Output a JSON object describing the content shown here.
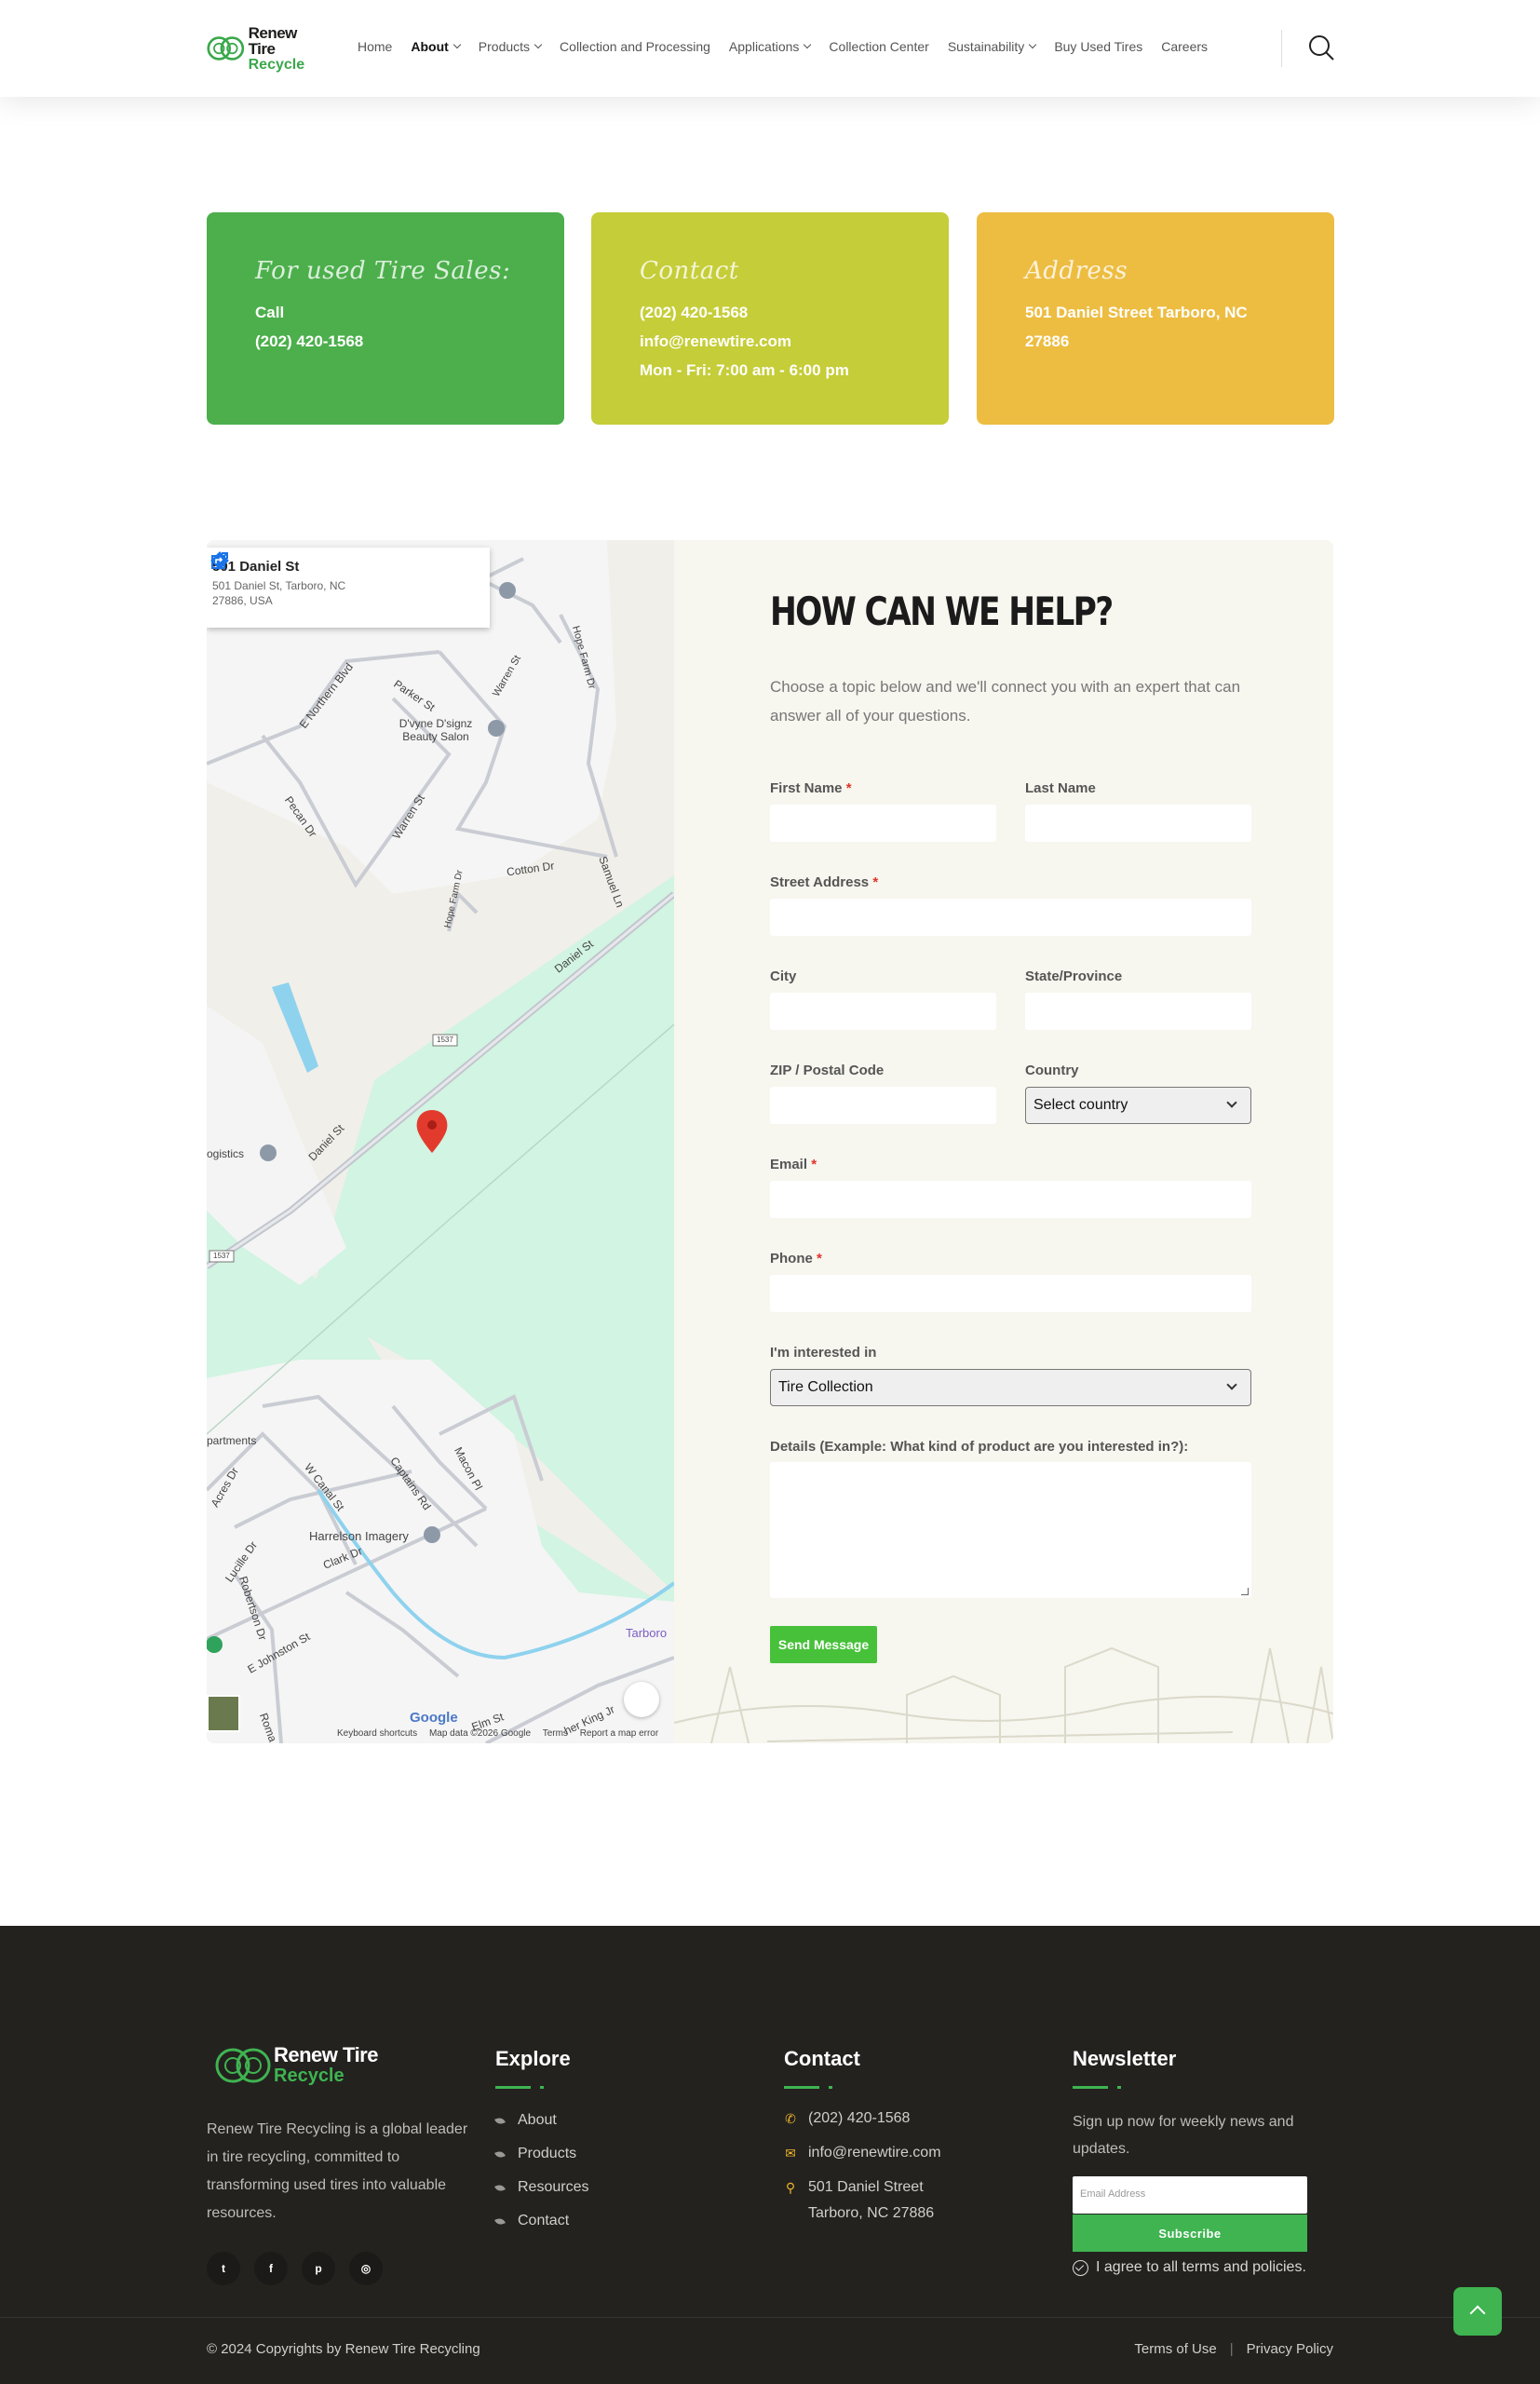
{
  "header": {
    "logo": {
      "line1": "Renew Tire",
      "line2": "Recycle"
    },
    "nav": [
      {
        "label": "Home",
        "dropdown": false,
        "active": false
      },
      {
        "label": "About",
        "dropdown": true,
        "active": true
      },
      {
        "label": "Products",
        "dropdown": true,
        "active": false
      },
      {
        "label": "Collection and Processing",
        "dropdown": false,
        "active": false
      },
      {
        "label": "Applications",
        "dropdown": true,
        "active": false
      },
      {
        "label": "Collection Center",
        "dropdown": false,
        "active": false
      },
      {
        "label": "Sustainability",
        "dropdown": true,
        "active": false
      },
      {
        "label": "Buy Used Tires",
        "dropdown": false,
        "active": false
      },
      {
        "label": "Careers",
        "dropdown": false,
        "active": false
      }
    ],
    "search_icon": "search-icon"
  },
  "cards": [
    {
      "title": "For used Tire Sales:",
      "lines": [
        "Call",
        "(202) 420-1568"
      ],
      "color": "#4caf4c"
    },
    {
      "title": "Contact",
      "lines": [
        "(202) 420-1568",
        "info@renewtire.com",
        "Mon - Fri: 7:00 am - 6:00 pm"
      ],
      "color": "#c5cd38"
    },
    {
      "title": "Address",
      "lines": [
        "501 Daniel Street Tarboro, NC",
        "27886"
      ],
      "color": "#edbd42"
    }
  ],
  "map": {
    "place_title": "501 Daniel St",
    "place_address": "501 Daniel St, Tarboro, NC 27886, USA",
    "labels": {
      "northern": "E Northern Blvd",
      "parker": "Parker St",
      "warren1": "Warren St",
      "hope": "Hope Farm Dr",
      "salon": "D'vyne D'signz Beauty Salon",
      "pecan": "Pecan Dr",
      "warren2": "Warren St",
      "cotton": "Cotton Dr",
      "hopefarm2": "Hope Farm Dr",
      "samuel": "Samuel Ln",
      "daniel1": "Daniel St",
      "route1": "1537",
      "logistics": "ogistics",
      "daniel2": "Daniel St",
      "route2": "1537",
      "apartments": "partments",
      "acres": "Acres Dr",
      "wcanal": "W Canal St",
      "captains": "Captains Rd",
      "macon": "Macon Pl",
      "harrelson": "Harrelson Imagery",
      "lucille": "Lucille Dr",
      "clark": "Clark Dr",
      "robertson": "Robertson Dr",
      "ejohnston": "E Johnston St",
      "tarboro": "Tarboro",
      "elm": "Elm St",
      "king": "her King Jr",
      "roma": "Roma"
    },
    "google_logo": "Google",
    "footer": [
      "Keyboard shortcuts",
      "Map data ©2026 Google",
      "Terms",
      "Report a map error"
    ]
  },
  "form": {
    "title": "HOW CAN WE HELP?",
    "subtitle": "Choose a topic below and we'll connect you with an expert that can answer all of your questions.",
    "fields": {
      "first_name": "First Name",
      "last_name": "Last Name",
      "street": "Street Address",
      "city": "City",
      "state": "State/Province",
      "zip": "ZIP / Postal Code",
      "country": "Country",
      "email": "Email",
      "phone": "Phone",
      "interest": "I'm interested in",
      "details": "Details (Example: What kind of product are you interested in?):"
    },
    "required_mark": "*",
    "country_value": "Select country",
    "interest_value": "Tire Collection",
    "submit": "Send Message"
  },
  "footer": {
    "logo": {
      "line1": "Renew Tire",
      "line2": "Recycle"
    },
    "about": "Renew Tire Recycling is a global leader in tire recycling, committed to transforming used tires into valuable resources.",
    "socials": [
      "twitter-icon",
      "facebook-icon",
      "pinterest-icon",
      "instagram-icon"
    ],
    "explore_title": "Explore",
    "explore_links": [
      "About",
      "Products",
      "Resources",
      "Contact"
    ],
    "contact_title": "Contact",
    "contact_phone": "(202) 420-1568",
    "contact_email": "info@renewtire.com",
    "contact_address1": "501 Daniel Street",
    "contact_address2": "Tarboro, NC 27886",
    "newsletter_title": "Newsletter",
    "newsletter_text": "Sign up now for weekly news and updates.",
    "newsletter_placeholder": "Email Address",
    "subscribe": "Subscribe",
    "agree": "I agree to all terms and policies.",
    "copyright": "© 2024 Copyrights by Renew Tire Recycling",
    "terms": "Terms of Use",
    "divider": "|",
    "privacy": "Privacy Policy"
  },
  "colors": {
    "brand_green": "#3fb451",
    "card_green": "#4caf4c",
    "card_lime": "#c5cd38",
    "card_yellow": "#edbd42",
    "footer_bg": "#23221f",
    "submit_green": "#48c13a"
  }
}
